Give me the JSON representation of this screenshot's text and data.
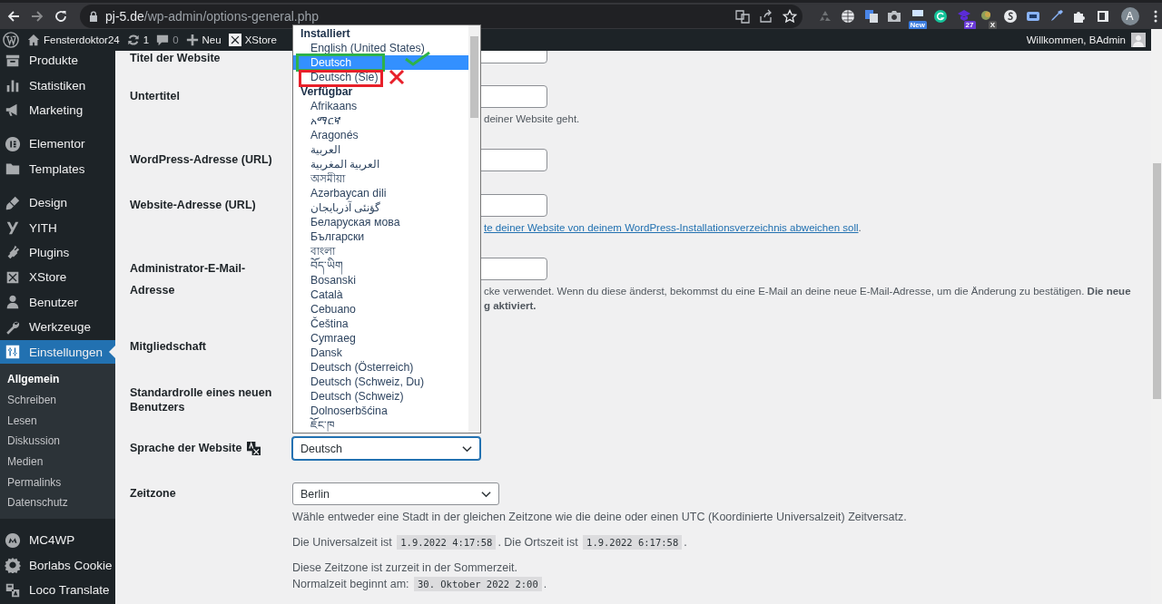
{
  "browser": {
    "url_host": "pj-5.de",
    "url_path": "/wp-admin/options-general.php",
    "extensions": [
      {
        "kind": "recycle"
      },
      {
        "kind": "globe"
      },
      {
        "kind": "translate"
      },
      {
        "kind": "camera"
      },
      {
        "kind": "app",
        "badge": "New"
      },
      {
        "kind": "grammar"
      },
      {
        "kind": "hat",
        "badge": "27"
      },
      {
        "kind": "orb",
        "badge": "X"
      },
      {
        "kind": "s-circle"
      },
      {
        "kind": "screen"
      },
      {
        "kind": "dropper"
      },
      {
        "kind": "puzzle"
      },
      {
        "kind": "sidepanel"
      }
    ],
    "profile": "A"
  },
  "admin_bar": {
    "site_name": "Fensterdoktor24",
    "updates": "1",
    "comments": "0",
    "new_label": "Neu",
    "xstore_label": "XStore",
    "greeting": "Willkommen, BAdmin"
  },
  "sidebar": {
    "groups": [
      [
        {
          "label": "Produkte",
          "selected": false
        },
        {
          "label": "Statistiken",
          "selected": false
        },
        {
          "label": "Marketing",
          "selected": false
        }
      ],
      [
        {
          "label": "Elementor",
          "selected": false
        },
        {
          "label": "Templates",
          "selected": false
        }
      ],
      [
        {
          "label": "Design",
          "selected": false
        },
        {
          "label": "YITH",
          "selected": false
        },
        {
          "label": "Plugins",
          "selected": false
        },
        {
          "label": "XStore",
          "selected": false
        },
        {
          "label": "Benutzer",
          "selected": false
        },
        {
          "label": "Werkzeuge",
          "selected": false
        },
        {
          "label": "Einstellungen",
          "selected": true,
          "children": [
            {
              "label": "Allgemein",
              "selected": true
            },
            {
              "label": "Schreiben",
              "selected": false
            },
            {
              "label": "Lesen",
              "selected": false
            },
            {
              "label": "Diskussion",
              "selected": false
            },
            {
              "label": "Medien",
              "selected": false
            },
            {
              "label": "Permalinks",
              "selected": false
            },
            {
              "label": "Datenschutz",
              "selected": false
            }
          ]
        }
      ],
      [
        {
          "label": "MC4WP",
          "selected": false
        },
        {
          "label": "Borlabs Cookie",
          "selected": false
        },
        {
          "label": "Loco Translate",
          "selected": false
        }
      ]
    ]
  },
  "settings": [
    {
      "label": "Titel der Website",
      "kind": "text"
    },
    {
      "label": "Untertitel",
      "kind": "text",
      "paragraphs": [
        [
          [
            {
              "kind": "text",
              "text": "deiner Website geht."
            }
          ]
        ]
      ]
    },
    {
      "label": "WordPress-Adresse (URL)",
      "kind": "text"
    },
    {
      "label": "Website-Adresse (URL)",
      "kind": "text",
      "paragraphs": [
        [
          [
            {
              "kind": "link",
              "text": "te deiner Website von deinem WordPress-Installationsverzeichnis abweichen soll"
            },
            {
              "kind": "text",
              "text": "."
            }
          ]
        ]
      ]
    },
    {
      "label": "Administrator-E-Mail-Adresse",
      "kind": "text",
      "paragraphs": [
        [
          [
            {
              "kind": "text",
              "text": "cke verwendet. Wenn du diese änderst, bekommst du eine E-Mail an deine neue E-Mail-Adresse, um die Änderung zu bestätigen. **Die neue**"
            }
          ],
          [
            {
              "kind": "text",
              "text": "**g aktiviert.**"
            }
          ]
        ]
      ]
    },
    {
      "label": "Mitgliedschaft",
      "kind": "checkbox"
    },
    {
      "label": "Standardrolle eines neuen Benutzers",
      "kind": "select"
    },
    {
      "label": "Sprache der Website",
      "kind": "language",
      "value": "Deutsch"
    },
    {
      "label": "Zeitzone",
      "kind": "timezone",
      "value": "Berlin",
      "paragraphs": [
        [
          [
            {
              "kind": "text",
              "text": "Wähle entweder eine Stadt in der gleichen Zeitzone wie die deine oder einen UTC (Koordinierte Universalzeit) Zeitversatz."
            }
          ]
        ],
        [
          [
            {
              "kind": "text",
              "text": "Die Universalzeit ist "
            },
            {
              "kind": "code",
              "text": "1.9.2022 4:17:58"
            },
            {
              "kind": "text",
              "text": ". Die Ortszeit ist "
            },
            {
              "kind": "code",
              "text": "1.9.2022 6:17:58"
            },
            {
              "kind": "text",
              "text": "."
            }
          ]
        ],
        [
          [
            {
              "kind": "text",
              "text": "Diese Zeitzone ist zurzeit in der Sommerzeit."
            }
          ],
          [
            {
              "kind": "text",
              "text": "Normalzeit beginnt am: "
            },
            {
              "kind": "code",
              "text": "30. Oktober 2022 2:00"
            },
            {
              "kind": "text",
              "text": "."
            }
          ]
        ]
      ]
    }
  ],
  "language_list": {
    "groups": [
      {
        "label": "Installiert",
        "options": [
          {
            "label": "English (United States)",
            "selected": false
          },
          {
            "label": "Deutsch",
            "selected": true,
            "kind": "check",
            "color": "#2db24a"
          },
          {
            "label": "Deutsch (Sie)",
            "selected": false,
            "kind": "cross",
            "color": "#e8202a"
          }
        ]
      },
      {
        "label": "Verfügbar",
        "options": [
          {
            "label": "Afrikaans",
            "selected": false
          },
          {
            "label": "አማርኛ",
            "selected": false
          },
          {
            "label": "Aragonés",
            "selected": false
          },
          {
            "label": "العربية",
            "selected": false
          },
          {
            "label": "العربية المغربية",
            "selected": false
          },
          {
            "label": "অসমীয়া",
            "selected": false
          },
          {
            "label": "Azərbaycan dili",
            "selected": false
          },
          {
            "label": "گؤنئی آذربایجان",
            "selected": false
          },
          {
            "label": "Беларуская мова",
            "selected": false
          },
          {
            "label": "Български",
            "selected": false
          },
          {
            "label": "বাংলা",
            "selected": false
          },
          {
            "label": "བོད་ཡིག",
            "selected": false
          },
          {
            "label": "Bosanski",
            "selected": false
          },
          {
            "label": "Català",
            "selected": false
          },
          {
            "label": "Cebuano",
            "selected": false
          },
          {
            "label": "Čeština",
            "selected": false
          },
          {
            "label": "Cymraeg",
            "selected": false
          },
          {
            "label": "Dansk",
            "selected": false
          },
          {
            "label": "Deutsch (Österreich)",
            "selected": false
          },
          {
            "label": "Deutsch (Schweiz, Du)",
            "selected": false
          },
          {
            "label": "Deutsch (Schweiz)",
            "selected": false
          },
          {
            "label": "Dolnoserbšćina",
            "selected": false
          },
          {
            "label": "ཇོང་ཁ",
            "selected": false
          }
        ]
      }
    ]
  }
}
